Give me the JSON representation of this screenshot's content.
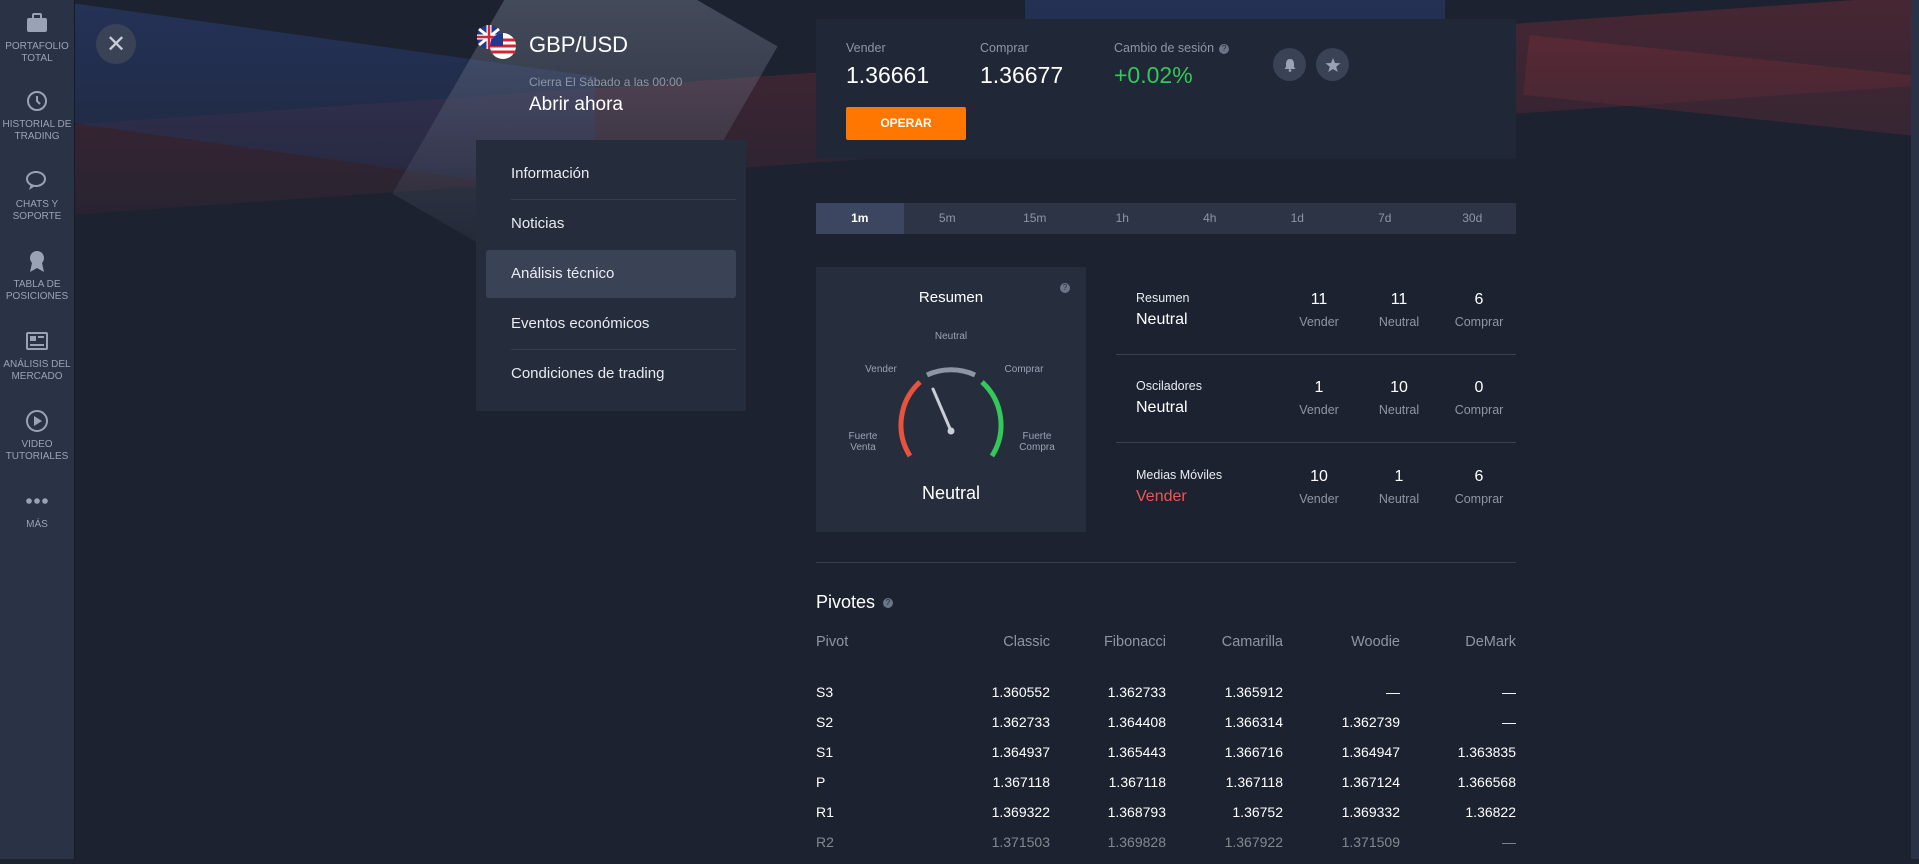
{
  "sidebar": {
    "items": [
      {
        "label_line1": "PORTAFOLIO",
        "label_line2": "TOTAL",
        "icon": "briefcase-icon"
      },
      {
        "label_line1": "HISTORIAL DE",
        "label_line2": "TRADING",
        "icon": "history-icon"
      },
      {
        "label_line1": "CHATS Y",
        "label_line2": "SOPORTE",
        "icon": "chat-icon"
      },
      {
        "label_line1": "TABLA DE",
        "label_line2": "POSICIONES",
        "icon": "award-icon"
      },
      {
        "label_line1": "ANÁLISIS DEL",
        "label_line2": "MERCADO",
        "icon": "newspaper-icon"
      },
      {
        "label_line1": "VIDEO",
        "label_line2": "TUTORIALES",
        "icon": "play-icon"
      },
      {
        "label_line1": "MÁS",
        "label_line2": "",
        "icon": "more-icon"
      }
    ]
  },
  "header": {
    "pair": "GBP/USD",
    "closes": "Cierra El Sábado a las 00:00",
    "open_now": "Abrir ahora"
  },
  "menu": {
    "items": [
      "Información",
      "Noticias",
      "Análisis técnico",
      "Eventos económicos",
      "Condiciones de trading"
    ],
    "active": "Análisis técnico"
  },
  "quote": {
    "sell_label": "Vender",
    "sell_value": "1.36661",
    "buy_label": "Comprar",
    "buy_value": "1.36677",
    "change_label": "Cambio de sesión",
    "change_value": "+0.02%",
    "trade_button": "OPERAR"
  },
  "timeframes": {
    "items": [
      "1m",
      "5m",
      "15m",
      "1h",
      "4h",
      "1d",
      "7d",
      "30d"
    ],
    "active": "1m"
  },
  "gauge": {
    "title": "Resumen",
    "labels": {
      "neutral": "Neutral",
      "sell": "Vender",
      "buy": "Comprar",
      "strong_sell_1": "Fuerte",
      "strong_sell_2": "Venta",
      "strong_buy_1": "Fuerte",
      "strong_buy_2": "Compra"
    },
    "result": "Neutral",
    "colors": {
      "sell": "#e8533f",
      "neutral": "#8e96a6",
      "buy": "#34c759"
    }
  },
  "summary": {
    "col_labels": [
      "Vender",
      "Neutral",
      "Comprar"
    ],
    "rows": [
      {
        "name": "Resumen",
        "status": "Neutral",
        "values": [
          "11",
          "11",
          "6"
        ]
      },
      {
        "name": "Osciladores",
        "status": "Neutral",
        "values": [
          "1",
          "10",
          "0"
        ]
      },
      {
        "name": "Medias Móviles",
        "status": "Vender",
        "values": [
          "10",
          "1",
          "6"
        ]
      }
    ]
  },
  "pivots": {
    "title": "Pivotes",
    "headers": [
      "Pivot",
      "Classic",
      "Fibonacci",
      "Camarilla",
      "Woodie",
      "DeMark"
    ],
    "rows": [
      [
        "S3",
        "1.360552",
        "1.362733",
        "1.365912",
        "—",
        "—"
      ],
      [
        "S2",
        "1.362733",
        "1.364408",
        "1.366314",
        "1.362739",
        "—"
      ],
      [
        "S1",
        "1.364937",
        "1.365443",
        "1.366716",
        "1.364947",
        "1.363835"
      ],
      [
        "P",
        "1.367118",
        "1.367118",
        "1.367118",
        "1.367124",
        "1.366568"
      ],
      [
        "R1",
        "1.369322",
        "1.368793",
        "1.36752",
        "1.369332",
        "1.36822"
      ],
      [
        "R2",
        "1.371503",
        "1.369828",
        "1.367922",
        "1.371509",
        "—"
      ]
    ]
  },
  "colors": {
    "accent": "#ff7700",
    "positive": "#34c759",
    "negative": "#f05454"
  }
}
